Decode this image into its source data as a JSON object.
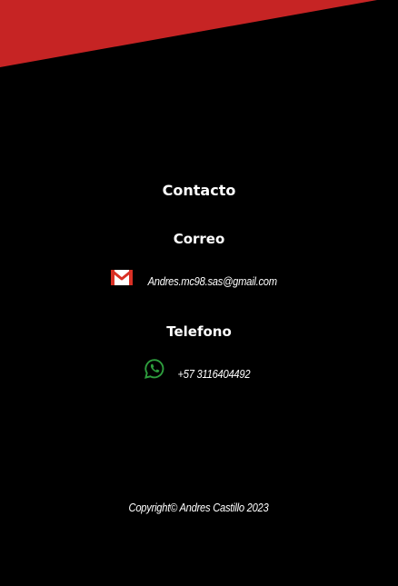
{
  "colors": {
    "background": "#000000",
    "accent": "#c62424",
    "text": "#ffffff",
    "whatsapp": "#2e9e3e"
  },
  "contact": {
    "heading": "Contacto"
  },
  "email": {
    "heading": "Correo",
    "icon": "gmail-icon",
    "address": "Andres.mc98.sas@gmail.com"
  },
  "phone": {
    "heading": "Telefono",
    "icon": "whatsapp-icon",
    "number": "+57 3116404492"
  },
  "footer": {
    "copyright": "Copyright© Andres Castillo 2023"
  }
}
